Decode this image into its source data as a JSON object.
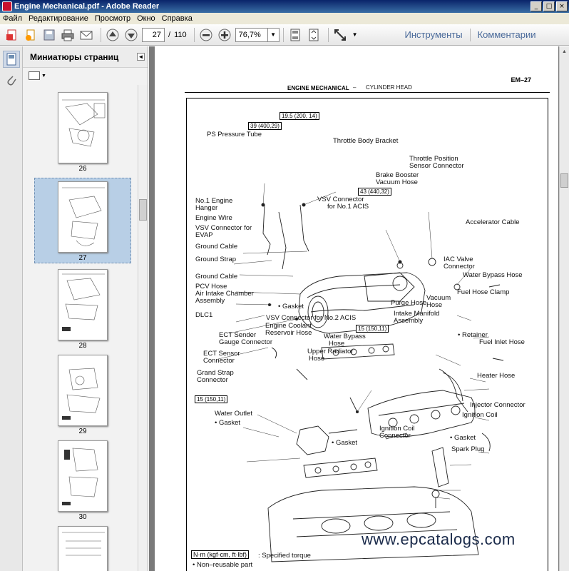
{
  "window": {
    "title": "Engine Mechanical.pdf - Adobe Reader",
    "controls": [
      "_",
      "□",
      "×"
    ]
  },
  "menu": [
    "Файл",
    "Редактирование",
    "Просмотр",
    "Окно",
    "Справка"
  ],
  "toolbar": {
    "current_page": "27",
    "page_separator": "/",
    "total_pages": "110",
    "zoom": "76,7%",
    "tools_label": "Инструменты",
    "comments_label": "Комментарии"
  },
  "thumbnails": {
    "panel_title": "Миниатюры страниц",
    "pages": [
      {
        "num": "26",
        "selected": false
      },
      {
        "num": "27",
        "selected": true
      },
      {
        "num": "28",
        "selected": false
      },
      {
        "num": "29",
        "selected": false
      },
      {
        "num": "30",
        "selected": false
      }
    ]
  },
  "document": {
    "page_id": "EM–27",
    "section": "ENGINE MECHANICAL",
    "dash": "–",
    "subsection": "CYLINDER HEAD",
    "torque_values": [
      "19.5 (200, 14)",
      "39 (400,29)",
      "43 (440,32)",
      "15 (150,11)",
      "15 (150,11)"
    ],
    "labels": [
      "PS Pressure Tube",
      "Throttle Body Bracket",
      "Throttle Position",
      "Sensor Connector",
      "Brake Booster",
      "Vacuum Hose",
      "No.1 Engine",
      "Hanger",
      "VSV Connector",
      "for No.1 ACIS",
      "Engine Wire",
      "VSV Connector for",
      "EVAP",
      "Accelerator Cable",
      "Ground Cable",
      "Ground Strap",
      "IAC Valve",
      "Connector",
      "Ground Cable",
      "Water Bypass Hose",
      "PCV Hose",
      "Air Intake Chamber",
      "Assembly",
      "Fuel Hose Clamp",
      "Vacuum",
      "Hose",
      "Purge Hose",
      "• Gasket",
      "DLC1",
      "VSV Connector for No.2 ACIS",
      "Intake Manifold",
      "Assembly",
      "Engine Coolant",
      "Reservoir Hose",
      "• Retainer",
      "ECT Sender",
      "Gauge Connector",
      "Water Bypass",
      "Hose",
      "Fuel Inlet Hose",
      "Upper Radiator",
      "Hose",
      "ECT Sensor",
      "Connector",
      "Grand Strap",
      "Connector",
      "Heater Hose",
      "Injector Connector",
      "Water Outlet",
      "• Gasket",
      "Ignition Coil",
      "Ignition Coil",
      "Connector",
      "• Gasket",
      "• Gasket",
      "Spark Plug"
    ],
    "legend_torque_box": "N·m (kgf·cm, ft·lbf)",
    "legend_torque_text": ": Specified torque",
    "legend_nonreusable": "•  Non–reusable part",
    "watermark": "www.epcatalogs.com"
  }
}
